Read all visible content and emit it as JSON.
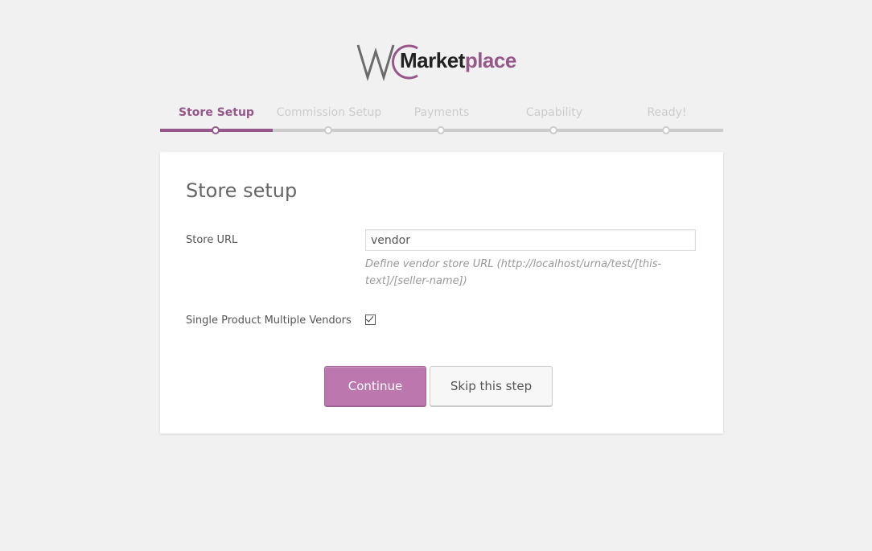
{
  "brand": {
    "logo_text_a": "Market",
    "logo_text_b": "place",
    "logo_icon": "wc-logo-icon",
    "colors": {
      "accent": "#96588a",
      "button": "#bb77ae",
      "background": "#f1f1f1"
    }
  },
  "steps": [
    {
      "label": "Store Setup",
      "active": true
    },
    {
      "label": "Commission Setup",
      "active": false
    },
    {
      "label": "Payments",
      "active": false
    },
    {
      "label": "Capability",
      "active": false
    },
    {
      "label": "Ready!",
      "active": false
    }
  ],
  "card": {
    "title": "Store setup",
    "store_url": {
      "label": "Store URL",
      "value": "vendor",
      "hint": "Define vendor store URL (http://localhost/urna/test/[this-text]/[seller-name])"
    },
    "spmv": {
      "label": "Single Product Multiple Vendors",
      "checked": true
    },
    "buttons": {
      "continue": "Continue",
      "skip": "Skip this step"
    }
  }
}
